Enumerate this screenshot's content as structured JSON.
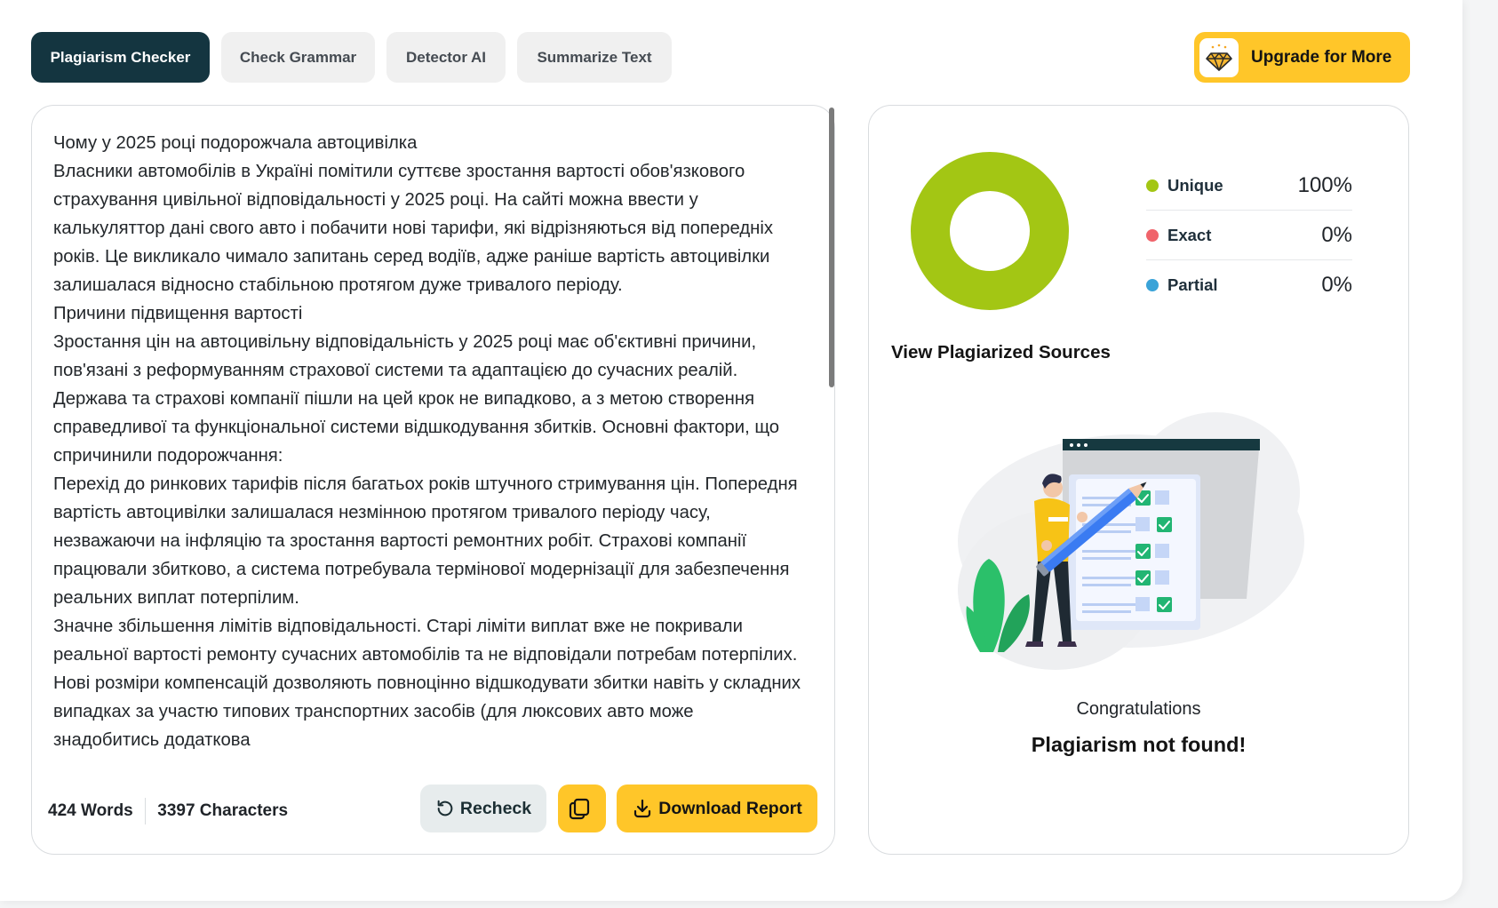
{
  "tabs": [
    {
      "label": "Plagiarism Checker",
      "active": true
    },
    {
      "label": "Check Grammar",
      "active": false
    },
    {
      "label": "Detector AI",
      "active": false
    },
    {
      "label": "Summarize Text",
      "active": false
    }
  ],
  "upgrade": {
    "label": "Upgrade for More",
    "icon": "diamond-icon"
  },
  "editor": {
    "paragraphs": [
      "Чому у 2025 році подорожчала автоцивілка",
      "Власники автомобілів в Україні помітили суттєве зростання вартості обов'язкового страхування цивільної відповідальності у 2025 році. На сайті можна ввести у калькуляттор дані свого авто і побачити нові тарифи, які відрізняються від попередніх років. Це викликало чимало запитань серед водіїв, адже раніше вартість автоцивілки залишалася відносно стабільною протягом дуже тривалого періоду.",
      "Причини підвищення вартості",
      "Зростання цін на автоцивільну відповідальність у 2025 році має об'єктивні причини, пов'язані з реформуванням страхової системи та адаптацією до сучасних реалій. Держава та страхові компанії пішли на цей крок не випадково, а з метою створення справедливої та функціональної системи відшкодування збитків. Основні фактори, що спричинили подорожчання:",
      "Перехід до ринкових тарифів після багатьох років штучного стримування цін. Попередня вартість автоцивілки залишалася незмінною протягом тривалого періоду часу, незважаючи на інфляцію та зростання вартості ремонтних робіт. Страхові компанії працювали збитково, а система потребувала термінової модернізації для забезпечення реальних виплат потерпілим.",
      "Значне збільшення лімітів відповідальності. Старі ліміти виплат вже не покривали реальної вартості ремонту сучасних автомобілів та не відповідали потребам потерпілих. Нові розміри компенсацій дозволяють повноцінно відшкодувати збитки навіть у складних випадках за участю типових транспортних засобів (для люксових авто може знадобитись додаткова"
    ],
    "word_count": "424 Words",
    "char_count": "3397 Characters",
    "scroll_fraction": 0.42
  },
  "actions": {
    "recheck_label": "Recheck",
    "copy_icon": "copy-icon",
    "download_label": "Download Report"
  },
  "results": {
    "legend": [
      {
        "name": "Unique",
        "value": "100%",
        "color": "#a3c614"
      },
      {
        "name": "Exact",
        "value": "0%",
        "color": "#f0646b"
      },
      {
        "name": "Partial",
        "value": "0%",
        "color": "#3aa3d8"
      }
    ],
    "unique_fraction": 1.0,
    "sources_link": "View Plagiarized Sources",
    "congrats_title": "Congratulations",
    "congrats_message": "Plagiarism not found!"
  },
  "colors": {
    "accent_dark": "#143540",
    "accent_yellow": "#ffc629",
    "unique_green": "#a3c614"
  }
}
